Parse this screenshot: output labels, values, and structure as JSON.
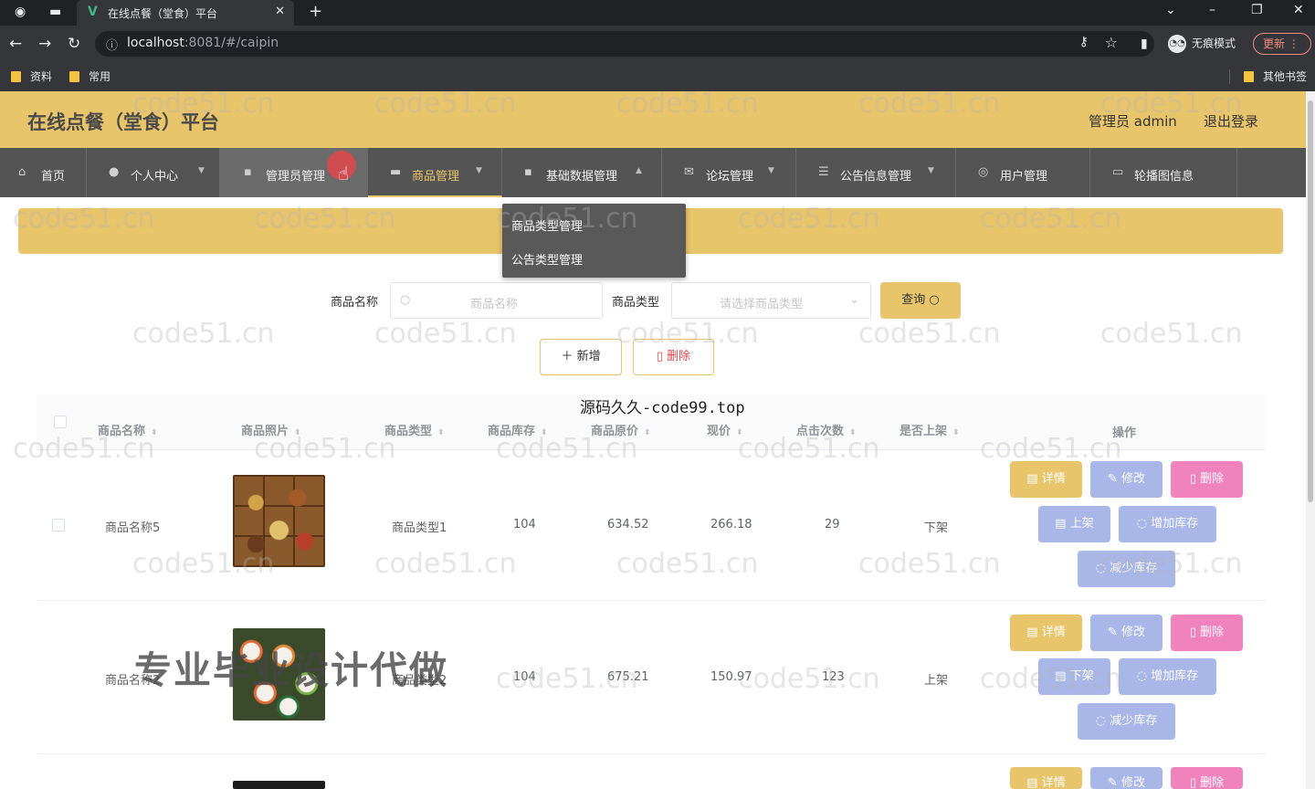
{
  "browser": {
    "tab_title": "在线点餐（堂食）平台",
    "tab_close": "✕",
    "new_tab": "+",
    "url_host": "localhost",
    "url_path": ":8081/#/caipin",
    "incognito_label": "无痕模式",
    "update_label": "更新",
    "bookmarks": [
      "资料",
      "常用"
    ],
    "other_bookmarks": "其他书签"
  },
  "header": {
    "title": "在线点餐（堂食）平台",
    "admin_role": "管理员 admin",
    "logout": "退出登录"
  },
  "menu": [
    {
      "label": "首页",
      "icon": "home-icon"
    },
    {
      "label": "个人中心",
      "icon": "user-icon"
    },
    {
      "label": "管理员管理",
      "icon": "admin-icon"
    },
    {
      "label": "商品管理",
      "icon": "goods-icon"
    },
    {
      "label": "基础数据管理",
      "icon": "data-icon"
    },
    {
      "label": "论坛管理",
      "icon": "forum-icon"
    },
    {
      "label": "公告信息管理",
      "icon": "notice-icon"
    },
    {
      "label": "用户管理",
      "icon": "users-icon"
    },
    {
      "label": "轮播图信息",
      "icon": "carousel-icon"
    }
  ],
  "dropdown": [
    "商品类型管理",
    "公告类型管理"
  ],
  "search": {
    "name_label": "商品名称",
    "name_placeholder": "商品名称",
    "type_label": "商品类型",
    "type_placeholder": "请选择商品类型",
    "query_button": "查询"
  },
  "actions": {
    "add": "新增",
    "delete": "删除"
  },
  "watermark_text": "源码久久-code99.top",
  "table": {
    "headers": [
      "商品名称",
      "商品照片",
      "商品类型",
      "商品库存",
      "商品原价",
      "现价",
      "点击次数",
      "是否上架",
      "操作"
    ],
    "rows": [
      {
        "name": "商品名称5",
        "type": "商品类型1",
        "stock": "104",
        "orig_price": "634.52",
        "price": "266.18",
        "clicks": "29",
        "status": "下架",
        "shelf_action": "上架"
      },
      {
        "name": "商品名称2",
        "type": "商品类型2",
        "stock": "104",
        "orig_price": "675.21",
        "price": "150.97",
        "clicks": "123",
        "status": "上架",
        "shelf_action": "下架"
      },
      {
        "name": "",
        "type": "",
        "stock": "",
        "orig_price": "",
        "price": "",
        "clicks": "",
        "status": "",
        "shelf_action": ""
      }
    ],
    "row_buttons": {
      "detail": "详情",
      "edit": "修改",
      "remove": "删除",
      "add_stock": "增加库存",
      "sub_stock": "减少库存"
    }
  },
  "overlay_promo": "专业毕业设计代做",
  "site_watermark": "code51.cn",
  "colors": {
    "accent": "#e8c46a",
    "menu_bg": "#545454",
    "pink": "#f082be",
    "lavender": "#a9b6e8"
  }
}
